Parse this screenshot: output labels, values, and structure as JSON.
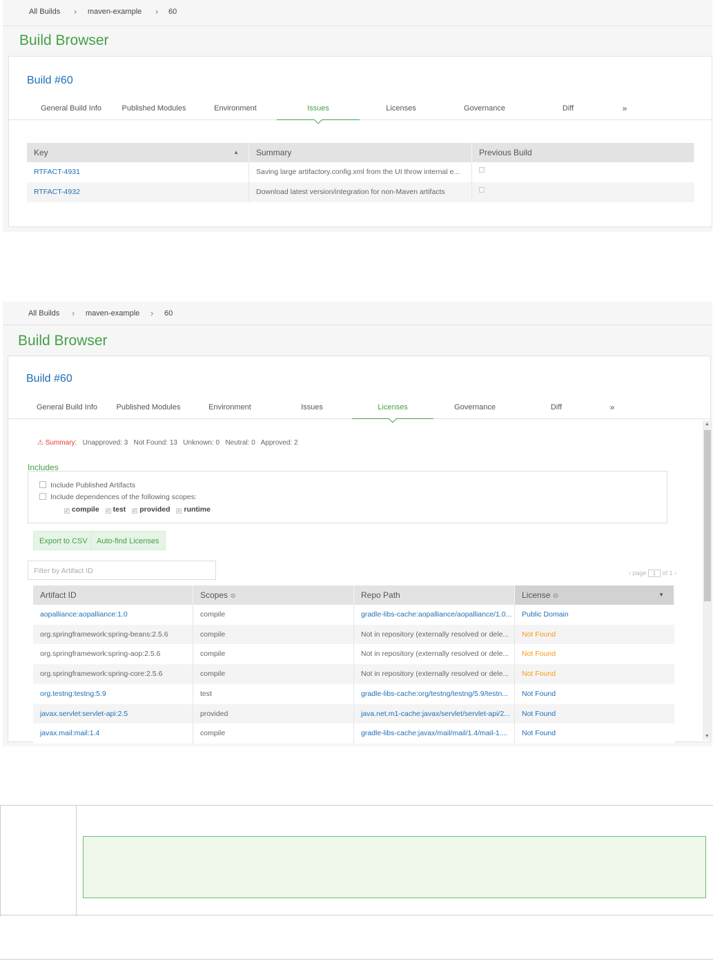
{
  "breadcrumb": {
    "items": [
      "All Builds",
      "maven-example",
      "60"
    ],
    "separator": "›"
  },
  "page_title": "Build Browser",
  "build_title": "Build #60",
  "tabs": [
    "General Build Info",
    "Published Modules",
    "Environment",
    "Issues",
    "Licenses",
    "Governance",
    "Diff",
    "»"
  ],
  "issues": {
    "columns": [
      "Key",
      "Summary",
      "Previous Build"
    ],
    "rows": [
      {
        "key": "RTFACT-4931",
        "summary": "Saving large artifactory.config.xml from the UI throw internal e..."
      },
      {
        "key": "RTFACT-4932",
        "summary": "Download latest version/integration for non-Maven artifacts"
      }
    ]
  },
  "licenses": {
    "summary": {
      "label": "Summary:",
      "stats": "Unapproved: 3   Not Found: 13   Unknown: 0   Neutral: 0   Approved: 2"
    },
    "includes_label": "Includes",
    "include_published": "Include Published Artifacts",
    "include_deps": "Include dependences of the following scopes:",
    "scopes": [
      "compile",
      "test",
      "provided",
      "runtime"
    ],
    "export_button": "Export to CSV",
    "autofind_button": "Auto-find Licenses",
    "filter_placeholder": "Filter by Artifact ID",
    "pager": {
      "page_label": "page",
      "page": "1",
      "of_label": "of 1"
    },
    "columns": [
      "Artifact ID",
      "Scopes",
      "Repo Path",
      "License"
    ],
    "rows": [
      {
        "artifact": "aopalliance:aopalliance:1.0",
        "scope": "compile",
        "repo": "gradle-libs-cache:aopalliance/aopalliance/1.0...",
        "license": "Public Domain",
        "artifact_link": true,
        "repo_link": true,
        "license_status": "link"
      },
      {
        "artifact": "org.springframework:spring-beans:2.5.6",
        "scope": "compile",
        "repo": "Not in repository (externally resolved or dele...",
        "license": "Not Found",
        "artifact_link": false,
        "repo_link": false,
        "license_status": "orange"
      },
      {
        "artifact": "org.springframework:spring-aop:2.5.6",
        "scope": "compile",
        "repo": "Not in repository (externally resolved or dele...",
        "license": "Not Found",
        "artifact_link": false,
        "repo_link": false,
        "license_status": "orange"
      },
      {
        "artifact": "org.springframework:spring-core:2.5.6",
        "scope": "compile",
        "repo": "Not in repository (externally resolved or dele...",
        "license": "Not Found",
        "artifact_link": false,
        "repo_link": false,
        "license_status": "orange"
      },
      {
        "artifact": "org.testng:testng:5.9",
        "scope": "test",
        "repo": "gradle-libs-cache:org/testng/testng/5.9/testn...",
        "license": "Not Found",
        "artifact_link": true,
        "repo_link": true,
        "license_status": "link"
      },
      {
        "artifact": "javax.servlet:servlet-api:2.5",
        "scope": "provided",
        "repo": "java.net.m1-cache:javax/servlet/servlet-api/2...",
        "license": "Not Found",
        "artifact_link": true,
        "repo_link": true,
        "license_status": "link"
      },
      {
        "artifact": "javax.mail:mail:1.4",
        "scope": "compile",
        "repo": "gradle-libs-cache:javax/mail/mail/1.4/mail-1....",
        "license": "Not Found",
        "artifact_link": true,
        "repo_link": true,
        "license_status": "link"
      }
    ]
  },
  "colors": {
    "accent_green": "#43a047",
    "link_blue": "#1e6fb8",
    "not_found_orange": "#f39c12",
    "warning_red": "#e53935"
  }
}
